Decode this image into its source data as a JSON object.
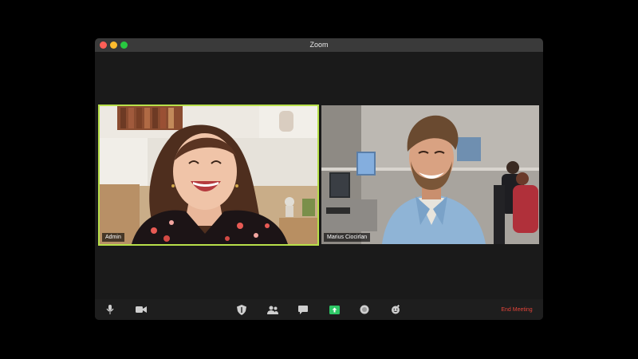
{
  "window": {
    "title": "Zoom"
  },
  "participants": [
    {
      "name": "Admin",
      "active_speaker": true
    },
    {
      "name": "Marius Ciocirlan",
      "active_speaker": false
    }
  ],
  "toolbar": {
    "end_meeting_label": "End Meeting",
    "icons": [
      "microphone-icon",
      "video-camera-icon",
      "security-shield-icon",
      "participants-icon",
      "chat-icon",
      "share-screen-icon",
      "record-icon",
      "reactions-icon"
    ]
  },
  "colors": {
    "active_speaker_border": "#b8e04a",
    "end_meeting_text": "#e2443a",
    "share_button": "#2ec866",
    "titlebar": "#3a3a3a"
  }
}
